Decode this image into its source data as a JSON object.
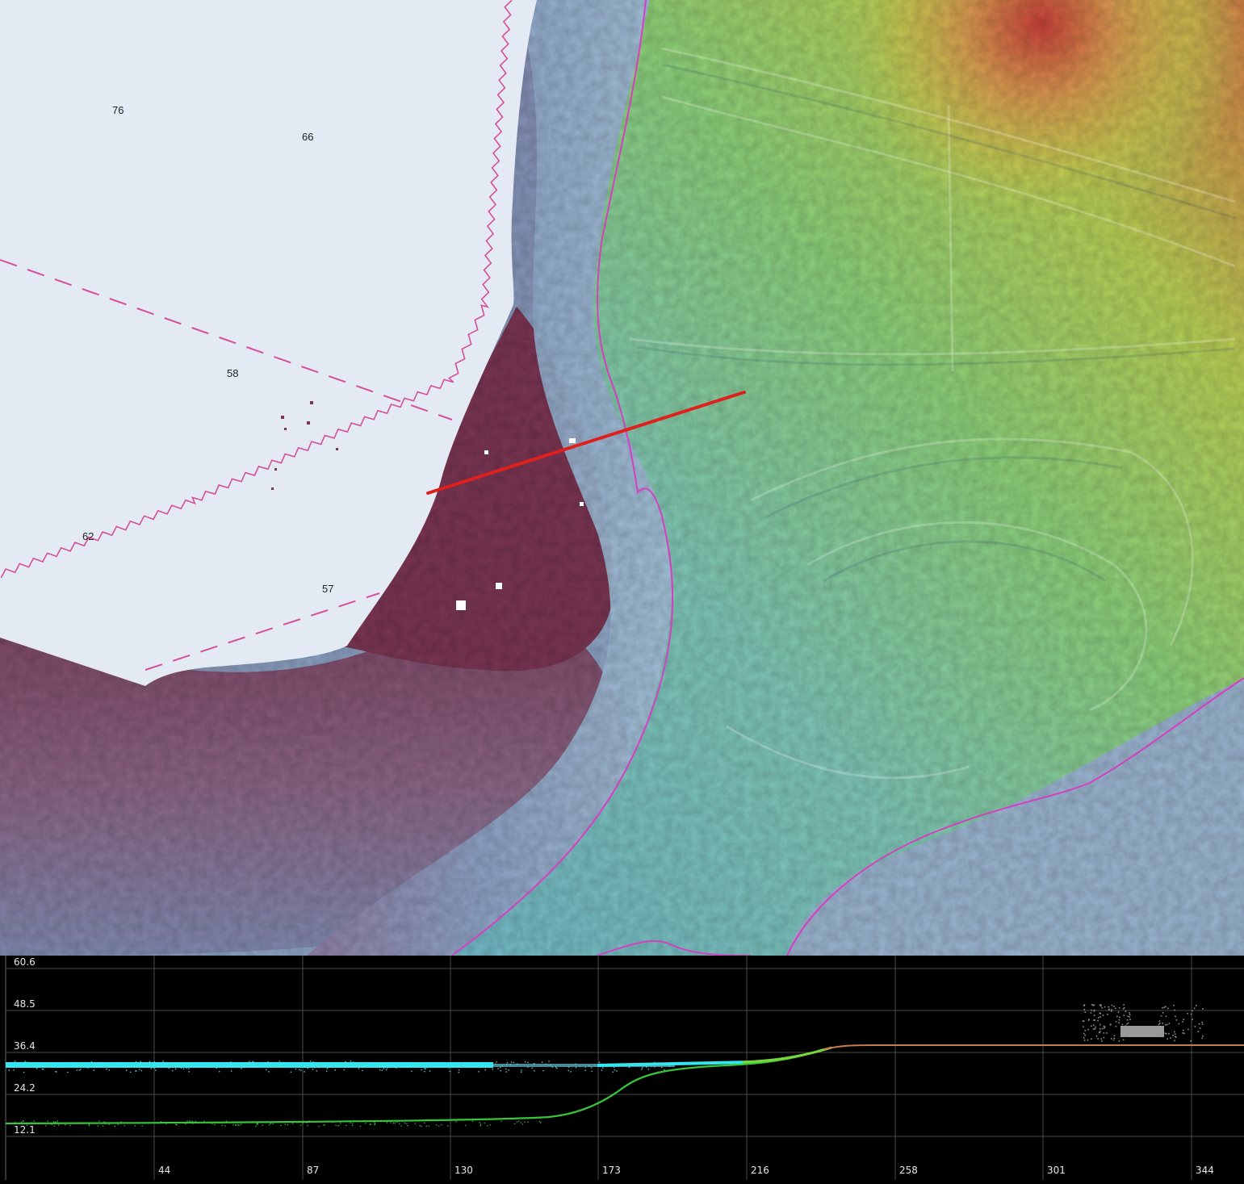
{
  "map": {
    "depth_labels": [
      {
        "id": "depth-76",
        "text": "76"
      },
      {
        "id": "depth-66",
        "text": "66"
      },
      {
        "id": "depth-58",
        "text": "58"
      },
      {
        "id": "depth-62",
        "text": "62"
      },
      {
        "id": "depth-57",
        "text": "57"
      }
    ],
    "colors": {
      "water": "#e4eaf4",
      "deep": "#7b3b55",
      "mid": "#5f90b8",
      "shelf": "#7fc4c2",
      "land_low": "#86c979",
      "land_high": "#d9b24f",
      "peak": "#d2533e",
      "contour": "#d5509a",
      "coastline": "#d63fbf",
      "profile_line": "#e0201c"
    }
  },
  "profile": {
    "y_ticks": [
      "60.6",
      "48.5",
      "36.4",
      "24.2",
      "12.1"
    ],
    "x_ticks": [
      "44",
      "87",
      "130",
      "173",
      "216",
      "258",
      "301",
      "344"
    ],
    "colors": {
      "water_surface": "#34e6ee",
      "seabed": "#37c63a",
      "land": "#c77c4d",
      "structure": "#9a9a9a"
    }
  }
}
